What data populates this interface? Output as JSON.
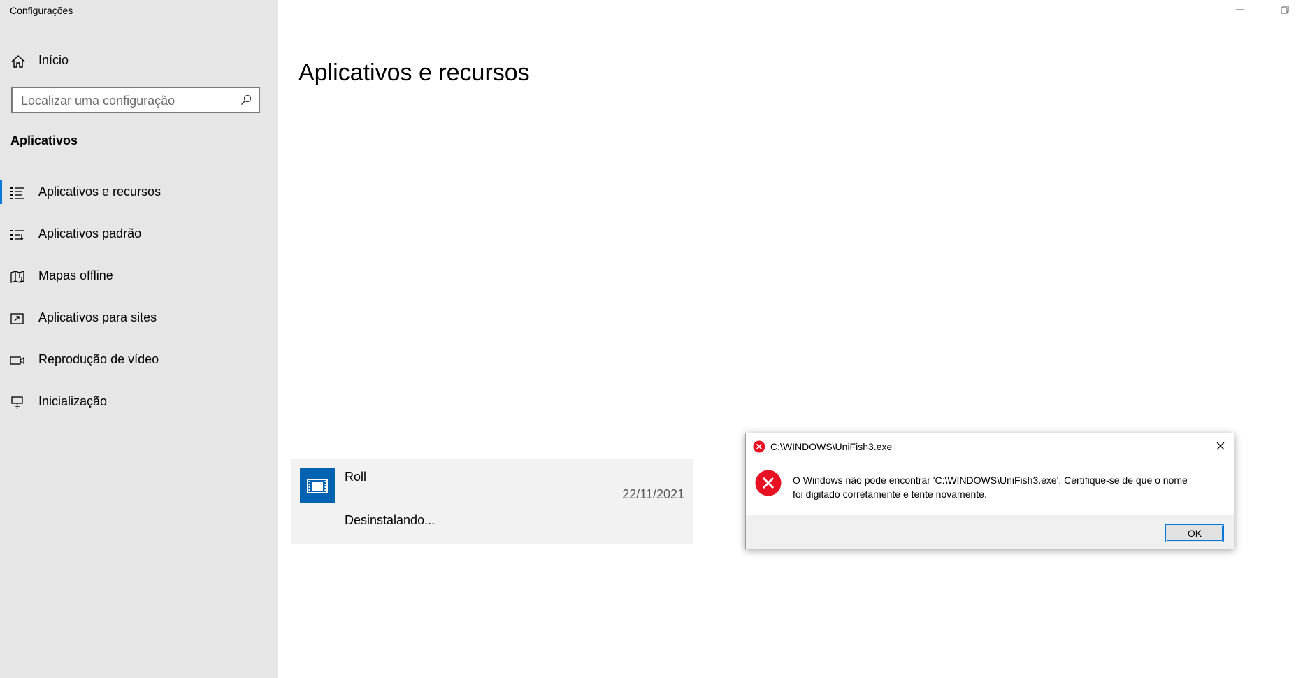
{
  "window": {
    "title": "Configurações",
    "minimize_icon": "minimize-icon",
    "restore_icon": "restore-icon"
  },
  "sidebar": {
    "home": {
      "label": "Início",
      "icon": "home-icon"
    },
    "search": {
      "placeholder": "Localizar uma configuração",
      "value": "",
      "icon": "search-icon"
    },
    "section_title": "Aplicativos",
    "items": [
      {
        "label": "Aplicativos e recursos",
        "icon": "apps-features-icon",
        "active": true
      },
      {
        "label": "Aplicativos padrão",
        "icon": "default-apps-icon",
        "active": false
      },
      {
        "label": "Mapas offline",
        "icon": "offline-maps-icon",
        "active": false
      },
      {
        "label": "Aplicativos para sites",
        "icon": "apps-for-websites-icon",
        "active": false
      },
      {
        "label": "Reprodução de vídeo",
        "icon": "video-playback-icon",
        "active": false
      },
      {
        "label": "Inicialização",
        "icon": "startup-icon",
        "active": false
      }
    ]
  },
  "main": {
    "title": "Aplicativos e recursos",
    "app": {
      "name": "Roll",
      "date": "22/11/2021",
      "status": "Desinstalando...",
      "icon": "app-icon"
    }
  },
  "dialog": {
    "title": "C:\\WINDOWS\\UniFish3.exe",
    "message_line1": "O Windows não pode encontrar 'C:\\WINDOWS\\UniFish3.exe'. Certifique-se de que o nome",
    "message_line2": "foi digitado corretamente e tente novamente.",
    "ok_label": "OK",
    "icon": "error-icon",
    "close_icon": "close-icon"
  },
  "colors": {
    "sidebar_bg": "#e6e6e6",
    "accent": "#0078d7",
    "app_icon_bg": "#0063b1",
    "error_red": "#e81123"
  }
}
